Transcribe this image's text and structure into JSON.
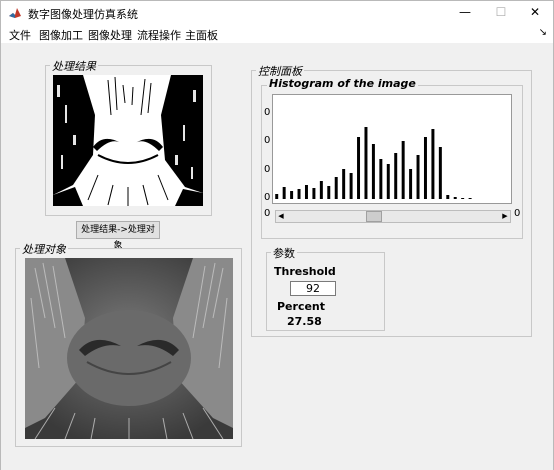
{
  "window": {
    "title": "数字图像处理仿真系统",
    "minimize": "—",
    "maximize": "☐",
    "close": "✕"
  },
  "menu": {
    "items": [
      "文件",
      "图像加工",
      "图像处理",
      "流程操作",
      "主面板"
    ],
    "arrow": "↘"
  },
  "result_panel": {
    "title": "处理结果"
  },
  "transfer_button": {
    "label": "处理结果->处理对象"
  },
  "object_panel": {
    "title": "处理对象"
  },
  "control_panel": {
    "title": "控制面板"
  },
  "histogram": {
    "title": "Histogram of the image",
    "y_tick_fragment": "0",
    "x_tick_left": "0",
    "x_tick_right": "0",
    "slider_position": 0.4
  },
  "params_panel": {
    "title": "参数"
  },
  "threshold": {
    "label": "Threshold",
    "value": "92"
  },
  "percent": {
    "label": "Percent",
    "value": "27.58"
  },
  "chart_data": {
    "type": "bar",
    "title": "Histogram of the image",
    "x": [
      0,
      8,
      16,
      24,
      32,
      40,
      48,
      56,
      64,
      72,
      80,
      88,
      96,
      104,
      112,
      120,
      128,
      136,
      144,
      152,
      160,
      168,
      176,
      184,
      192,
      200,
      208,
      216,
      224,
      232,
      240,
      248
    ],
    "values": [
      0.05,
      0.12,
      0.08,
      0.1,
      0.14,
      0.11,
      0.18,
      0.13,
      0.22,
      0.3,
      0.26,
      0.62,
      0.72,
      0.55,
      0.4,
      0.35,
      0.46,
      0.58,
      0.3,
      0.44,
      0.62,
      0.7,
      0.52,
      0.04,
      0.02,
      0.01,
      0.01,
      0.0,
      0.0,
      0.0,
      0.0,
      0.0
    ],
    "ylim": [
      0,
      1
    ],
    "grid": false
  }
}
